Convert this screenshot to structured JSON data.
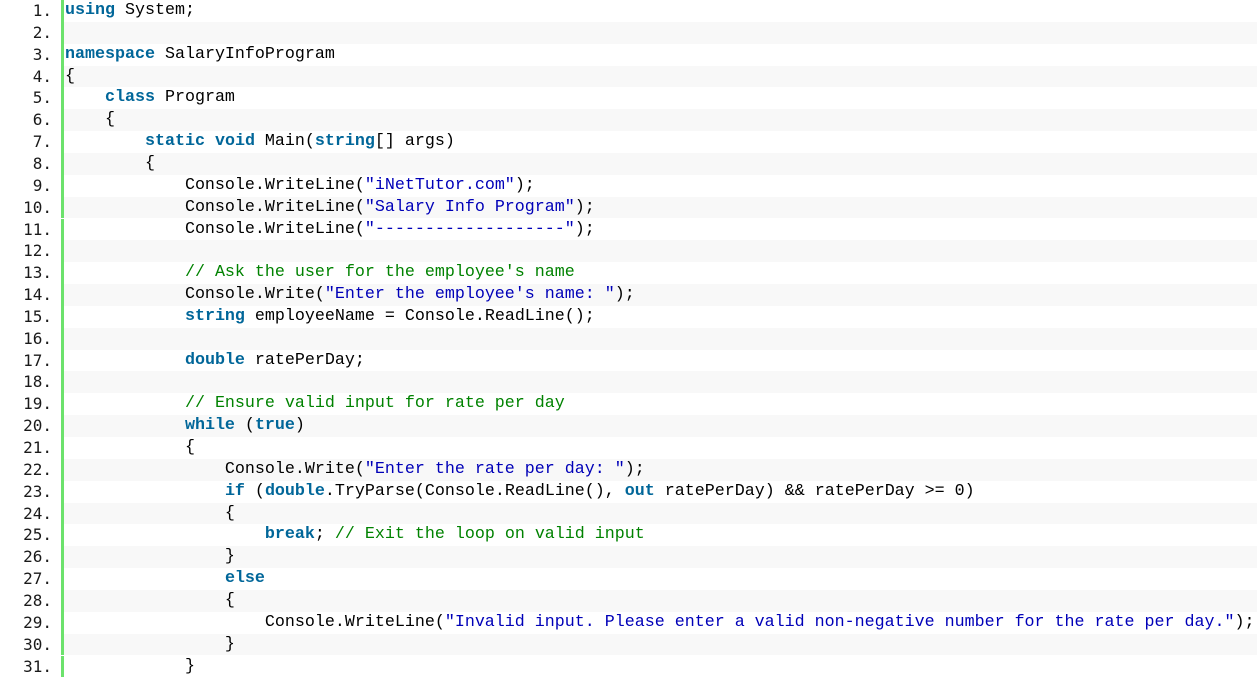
{
  "editor": {
    "language": "C#",
    "colors": {
      "keyword": "#006699",
      "string": "#0000b8",
      "comment": "#008200",
      "plain": "#000000",
      "gutter_bar": "#6ce26c",
      "alt_row": "#f8f8f8"
    },
    "lines": [
      {
        "number": "1.",
        "tokens": [
          {
            "t": "keyword",
            "v": "using"
          },
          {
            "t": "plain",
            "v": " System;"
          }
        ]
      },
      {
        "number": "2.",
        "tokens": []
      },
      {
        "number": "3.",
        "tokens": [
          {
            "t": "keyword",
            "v": "namespace"
          },
          {
            "t": "plain",
            "v": " SalaryInfoProgram"
          }
        ]
      },
      {
        "number": "4.",
        "tokens": [
          {
            "t": "plain",
            "v": "{"
          }
        ]
      },
      {
        "number": "5.",
        "tokens": [
          {
            "t": "plain",
            "v": "    "
          },
          {
            "t": "keyword",
            "v": "class"
          },
          {
            "t": "plain",
            "v": " Program"
          }
        ]
      },
      {
        "number": "6.",
        "tokens": [
          {
            "t": "plain",
            "v": "    {"
          }
        ]
      },
      {
        "number": "7.",
        "tokens": [
          {
            "t": "plain",
            "v": "        "
          },
          {
            "t": "keyword",
            "v": "static"
          },
          {
            "t": "plain",
            "v": " "
          },
          {
            "t": "keyword",
            "v": "void"
          },
          {
            "t": "plain",
            "v": " Main("
          },
          {
            "t": "keyword",
            "v": "string"
          },
          {
            "t": "plain",
            "v": "[] args)"
          }
        ]
      },
      {
        "number": "8.",
        "tokens": [
          {
            "t": "plain",
            "v": "        {"
          }
        ]
      },
      {
        "number": "9.",
        "tokens": [
          {
            "t": "plain",
            "v": "            Console.WriteLine("
          },
          {
            "t": "string",
            "v": "\"iNetTutor.com\""
          },
          {
            "t": "plain",
            "v": ");"
          }
        ]
      },
      {
        "number": "10.",
        "tokens": [
          {
            "t": "plain",
            "v": "            Console.WriteLine("
          },
          {
            "t": "string",
            "v": "\"Salary Info Program\""
          },
          {
            "t": "plain",
            "v": ");"
          }
        ]
      },
      {
        "number": "11.",
        "tokens": [
          {
            "t": "plain",
            "v": "            Console.WriteLine("
          },
          {
            "t": "string",
            "v": "\"-------------------\""
          },
          {
            "t": "plain",
            "v": ");"
          }
        ]
      },
      {
        "number": "12.",
        "tokens": []
      },
      {
        "number": "13.",
        "tokens": [
          {
            "t": "plain",
            "v": "            "
          },
          {
            "t": "comment",
            "v": "// Ask the user for the employee's name"
          }
        ]
      },
      {
        "number": "14.",
        "tokens": [
          {
            "t": "plain",
            "v": "            Console.Write("
          },
          {
            "t": "string",
            "v": "\"Enter the employee's name: \""
          },
          {
            "t": "plain",
            "v": ");"
          }
        ]
      },
      {
        "number": "15.",
        "tokens": [
          {
            "t": "plain",
            "v": "            "
          },
          {
            "t": "keyword",
            "v": "string"
          },
          {
            "t": "plain",
            "v": " employeeName = Console.ReadLine();"
          }
        ]
      },
      {
        "number": "16.",
        "tokens": []
      },
      {
        "number": "17.",
        "tokens": [
          {
            "t": "plain",
            "v": "            "
          },
          {
            "t": "keyword",
            "v": "double"
          },
          {
            "t": "plain",
            "v": " ratePerDay;"
          }
        ]
      },
      {
        "number": "18.",
        "tokens": []
      },
      {
        "number": "19.",
        "tokens": [
          {
            "t": "plain",
            "v": "            "
          },
          {
            "t": "comment",
            "v": "// Ensure valid input for rate per day"
          }
        ]
      },
      {
        "number": "20.",
        "tokens": [
          {
            "t": "plain",
            "v": "            "
          },
          {
            "t": "keyword",
            "v": "while"
          },
          {
            "t": "plain",
            "v": " ("
          },
          {
            "t": "keyword",
            "v": "true"
          },
          {
            "t": "plain",
            "v": ")"
          }
        ]
      },
      {
        "number": "21.",
        "tokens": [
          {
            "t": "plain",
            "v": "            {"
          }
        ]
      },
      {
        "number": "22.",
        "tokens": [
          {
            "t": "plain",
            "v": "                Console.Write("
          },
          {
            "t": "string",
            "v": "\"Enter the rate per day: \""
          },
          {
            "t": "plain",
            "v": ");"
          }
        ]
      },
      {
        "number": "23.",
        "tokens": [
          {
            "t": "plain",
            "v": "                "
          },
          {
            "t": "keyword",
            "v": "if"
          },
          {
            "t": "plain",
            "v": " ("
          },
          {
            "t": "keyword",
            "v": "double"
          },
          {
            "t": "plain",
            "v": ".TryParse(Console.ReadLine(), "
          },
          {
            "t": "keyword",
            "v": "out"
          },
          {
            "t": "plain",
            "v": " ratePerDay) && ratePerDay >= 0)"
          }
        ]
      },
      {
        "number": "24.",
        "tokens": [
          {
            "t": "plain",
            "v": "                {"
          }
        ]
      },
      {
        "number": "25.",
        "tokens": [
          {
            "t": "plain",
            "v": "                    "
          },
          {
            "t": "keyword",
            "v": "break"
          },
          {
            "t": "plain",
            "v": "; "
          },
          {
            "t": "comment",
            "v": "// Exit the loop on valid input"
          }
        ]
      },
      {
        "number": "26.",
        "tokens": [
          {
            "t": "plain",
            "v": "                }"
          }
        ]
      },
      {
        "number": "27.",
        "tokens": [
          {
            "t": "plain",
            "v": "                "
          },
          {
            "t": "keyword",
            "v": "else"
          }
        ]
      },
      {
        "number": "28.",
        "tokens": [
          {
            "t": "plain",
            "v": "                {"
          }
        ]
      },
      {
        "number": "29.",
        "tokens": [
          {
            "t": "plain",
            "v": "                    Console.WriteLine("
          },
          {
            "t": "string",
            "v": "\"Invalid input. Please enter a valid non-negative number for the rate per day.\""
          },
          {
            "t": "plain",
            "v": ");"
          }
        ]
      },
      {
        "number": "30.",
        "tokens": [
          {
            "t": "plain",
            "v": "                }"
          }
        ]
      },
      {
        "number": "31.",
        "tokens": [
          {
            "t": "plain",
            "v": "            }"
          }
        ]
      }
    ]
  }
}
